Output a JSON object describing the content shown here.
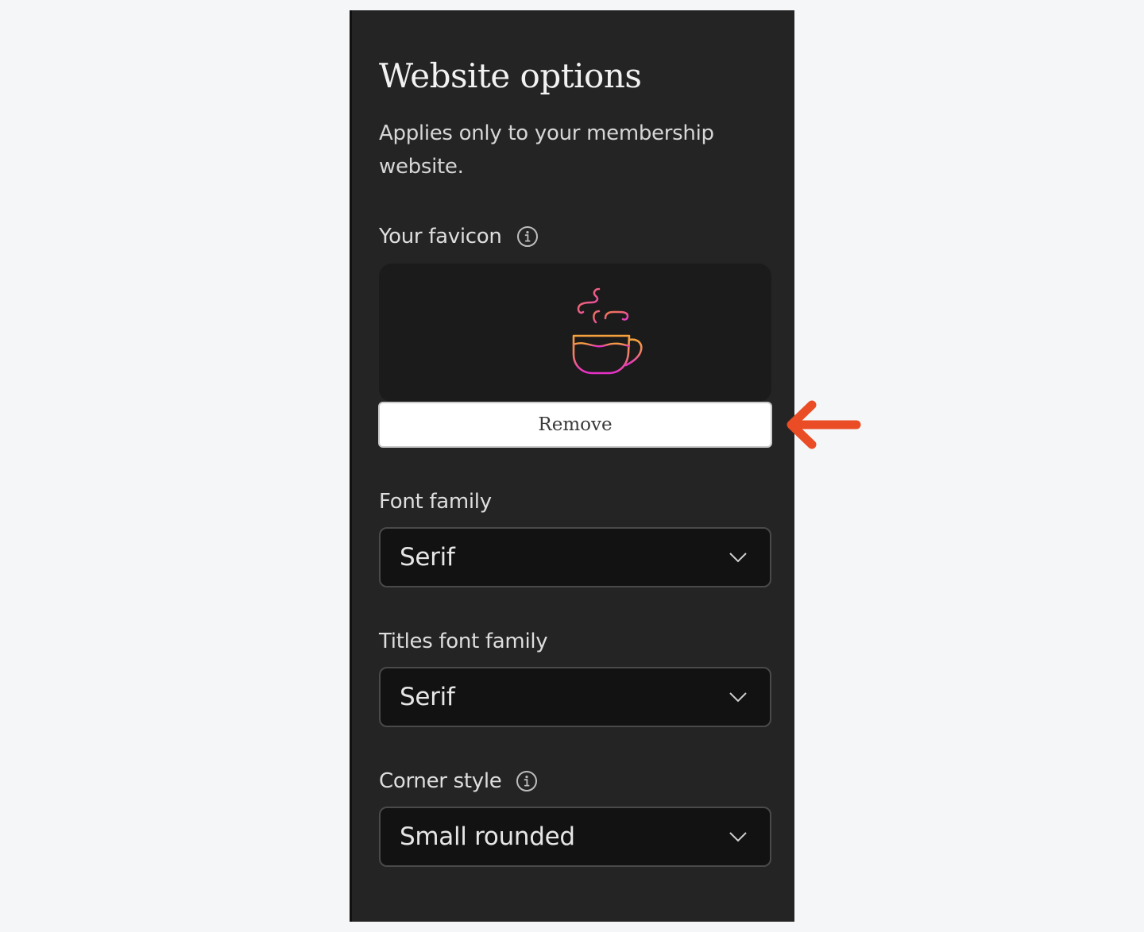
{
  "panel": {
    "title": "Website options",
    "subtitle": "Applies only to your membership website."
  },
  "favicon": {
    "label": "Your favicon",
    "remove_label": "Remove",
    "icon": "coffee-cup-icon"
  },
  "font_family": {
    "label": "Font family",
    "value": "Serif"
  },
  "titles_font_family": {
    "label": "Titles font family",
    "value": "Serif"
  },
  "corner_style": {
    "label": "Corner style",
    "value": "Small rounded"
  },
  "colors": {
    "panel_bg": "#242424",
    "page_bg": "#f5f6f8",
    "annotation_arrow": "#ea4c25",
    "icon_gradient_start": "#f5a13c",
    "icon_gradient_end": "#e62ec9"
  }
}
